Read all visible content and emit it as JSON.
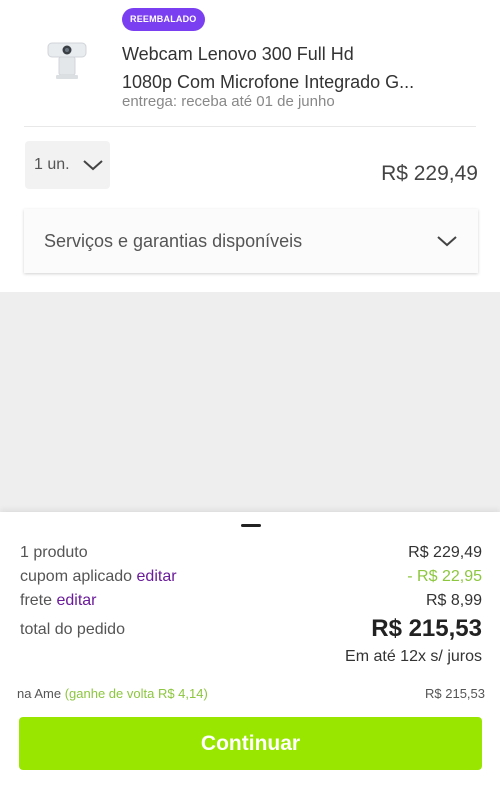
{
  "product": {
    "badge": "REEMBALADO",
    "title_line1": "Webcam Lenovo 300 Full Hd",
    "title_line2": "1080p Com Microfone Integrado G...",
    "delivery": "entrega: receba até 01 de junho",
    "quantity": "1 un.",
    "price": "R$ 229,49",
    "services_label": "Serviços e garantias disponíveis"
  },
  "summary": {
    "products_label": "1 produto",
    "products_value": "R$ 229,49",
    "coupon_label": "cupom aplicado",
    "coupon_edit": "editar",
    "coupon_value": "- R$ 22,95",
    "shipping_label": "frete",
    "shipping_edit": "editar",
    "shipping_value": "R$ 8,99",
    "total_label": "total do pedido",
    "total_value": "R$ 215,53",
    "installments": "Em até 12x s/ juros",
    "ame_label": "na Ame",
    "ame_cashback": "(ganhe de volta R$ 4,14)",
    "ame_value": "R$ 215,53",
    "continue_label": "Continuar"
  },
  "colors": {
    "badge": "#7b3ff2",
    "accent_green": "#8dc63f",
    "continue_button": "#99e600",
    "link_purple": "#6a1b9a"
  }
}
